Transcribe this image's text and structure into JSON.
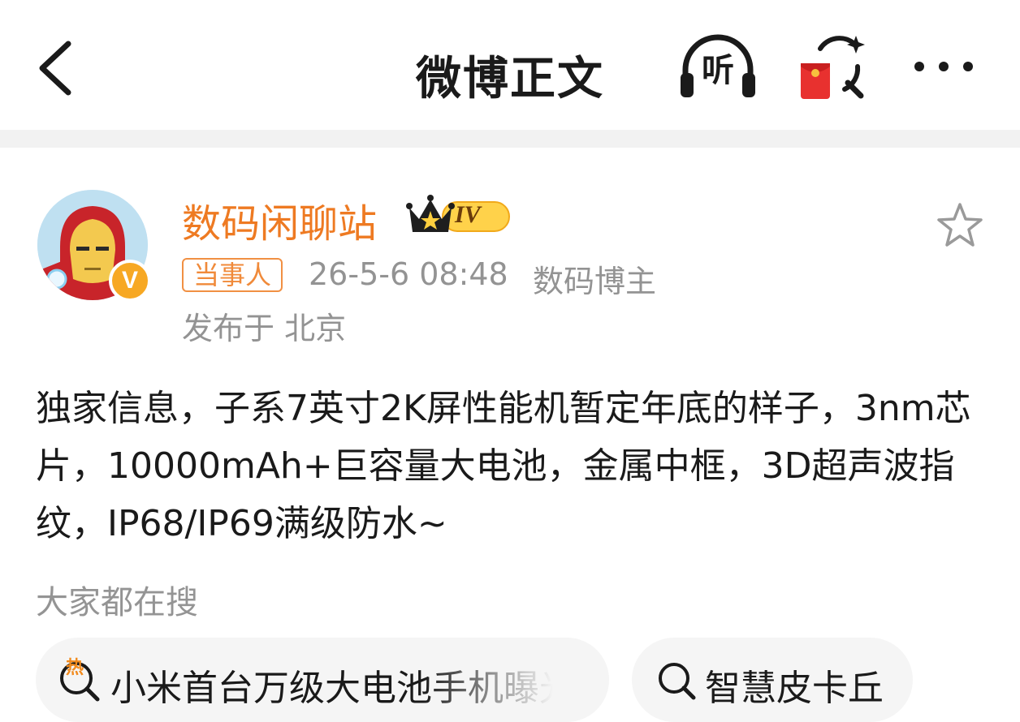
{
  "nav": {
    "title": "微博正文",
    "listen_label": "听"
  },
  "author": {
    "name": "数码闲聊站",
    "level": "IV",
    "tag": "当事人",
    "time": "26-5-6 08:48",
    "role": "数码博主",
    "location": "发布于 北京",
    "verified_mark": "V"
  },
  "post": {
    "text": "独家信息，子系7英寸2K屏性能机暂定年底的样子，3nm芯片，10000mAh+巨容量大电池，金属中框，3D超声波指纹，IP68/IP69满级防水~"
  },
  "trending": {
    "title": "大家都在搜",
    "items": [
      {
        "label": "小米首台万级大电池手机曝光",
        "icon": "hot-search-icon",
        "hot_mark": "热"
      },
      {
        "label": "智慧皮卡丘",
        "icon": "search-icon"
      }
    ]
  },
  "colors": {
    "brand_orange": "#ee7a22",
    "meta_gray": "#939393",
    "chip_bg": "#f5f5f5"
  }
}
